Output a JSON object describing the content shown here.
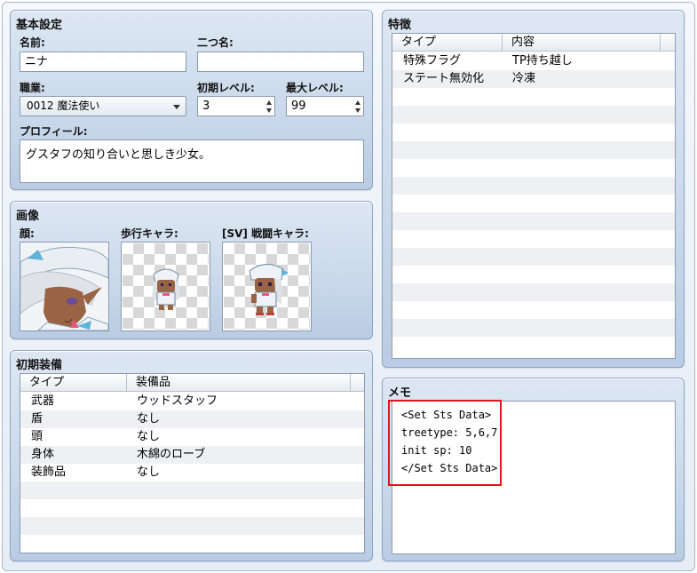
{
  "basic": {
    "title": "基本設定",
    "name_label": "名前:",
    "name_value": "ニナ",
    "nickname_label": "二つ名:",
    "nickname_value": "",
    "class_label": "職業:",
    "class_value": "0012 魔法使い",
    "init_level_label": "初期レベル:",
    "init_level_value": "3",
    "max_level_label": "最大レベル:",
    "max_level_value": "99",
    "profile_label": "プロフィール:",
    "profile_value": "グスタフの知り合いと思しき少女。"
  },
  "images": {
    "title": "画像",
    "face_label": "顔:",
    "walk_label": "歩行キャラ:",
    "battler_label": "[SV] 戦闘キャラ:"
  },
  "equipment": {
    "title": "初期装備",
    "columns": [
      "タイプ",
      "装備品"
    ],
    "rows": [
      {
        "type": "武器",
        "item": "ウッドスタッフ"
      },
      {
        "type": "盾",
        "item": "なし"
      },
      {
        "type": "頭",
        "item": "なし"
      },
      {
        "type": "身体",
        "item": "木綿のローブ"
      },
      {
        "type": "装飾品",
        "item": "なし"
      }
    ]
  },
  "traits": {
    "title": "特徴",
    "columns": [
      "タイプ",
      "内容"
    ],
    "rows": [
      {
        "type": "特殊フラグ",
        "content": "TP持ち越し"
      },
      {
        "type": "ステート無効化",
        "content": "冷凍"
      }
    ]
  },
  "memo": {
    "title": "メモ",
    "lines": [
      "<Set Sts Data>",
      "treetype: 5,6,7",
      "init sp: 10",
      "</Set Sts Data>"
    ],
    "highlight_color": "#e0141e"
  },
  "colors": {
    "panel_top": "#dde7f3",
    "panel_bottom": "#b9cce3",
    "border": "#8fa6c2"
  }
}
